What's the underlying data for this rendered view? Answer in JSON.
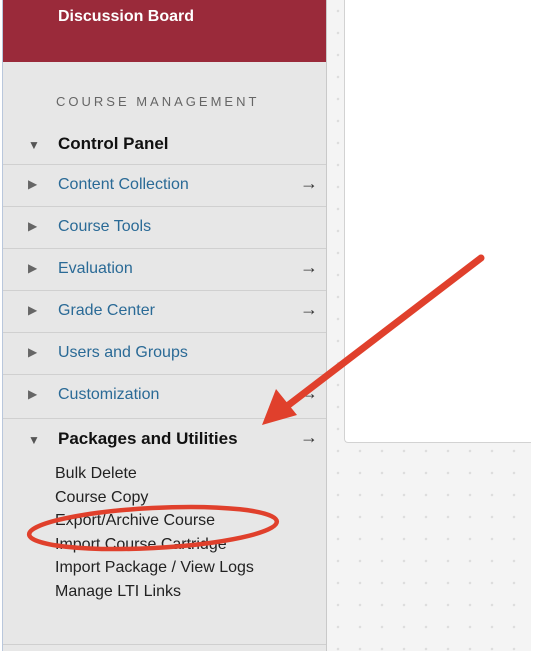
{
  "top_bar": {
    "label": "Discussion Board"
  },
  "section_heading": "COURSE MANAGEMENT",
  "control_panel": {
    "label": "Control Panel"
  },
  "nav_items": [
    {
      "label": "Content Collection",
      "arrow": "→"
    },
    {
      "label": "Course Tools",
      "arrow": ""
    },
    {
      "label": "Evaluation",
      "arrow": "→"
    },
    {
      "label": "Grade Center",
      "arrow": "→"
    },
    {
      "label": "Users and Groups",
      "arrow": ""
    },
    {
      "label": "Customization",
      "arrow": "→"
    }
  ],
  "packages_utilities": {
    "label": "Packages and Utilities",
    "arrow": "→",
    "items": [
      "Bulk Delete",
      "Course Copy",
      "Export/Archive Course",
      "Import Course Cartridge",
      "Import Package / View Logs",
      "Manage LTI Links"
    ]
  },
  "colors": {
    "top_bar": "#9a2a3a",
    "link": "#2a6a96",
    "annotation": "#e0402c"
  },
  "icons": {
    "expanded": "triangle-down-icon",
    "collapsed": "triangle-right-icon",
    "navigate": "arrow-right-icon"
  }
}
